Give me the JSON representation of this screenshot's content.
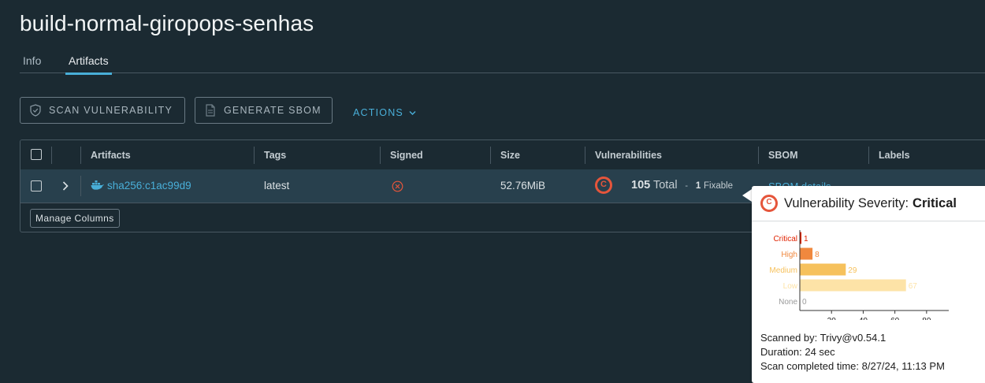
{
  "page": {
    "title": "build-normal-giropops-senhas",
    "tabs": [
      {
        "label": "Info",
        "active": false
      },
      {
        "label": "Artifacts",
        "active": true
      }
    ]
  },
  "toolbar": {
    "scan_label": "SCAN VULNERABILITY",
    "sbom_label": "GENERATE SBOM",
    "actions_label": "ACTIONS"
  },
  "grid": {
    "columns": [
      "Artifacts",
      "Tags",
      "Signed",
      "Size",
      "Vulnerabilities",
      "SBOM",
      "Labels"
    ],
    "row": {
      "digest": "sha256:c1ac99d9",
      "tag": "latest",
      "size": "52.76MiB",
      "vuln_total": "105",
      "vuln_total_word": "Total",
      "vuln_dash": "-",
      "vuln_fixable_count": "1",
      "vuln_fixable_word": "Fixable",
      "sbom_link": "SBOM details"
    },
    "manage_columns": "Manage Columns"
  },
  "popover": {
    "title_prefix": "Vulnerability Severity:",
    "title_value": "Critical",
    "icon_letter": "C",
    "scanned_by": "Scanned by: Trivy@v0.54.1",
    "duration": "Duration: 24 sec",
    "completed": "Scan completed time: 8/27/24, 11:13 PM"
  },
  "chart_data": {
    "type": "bar",
    "orientation": "horizontal",
    "categories": [
      "Critical",
      "High",
      "Medium",
      "Low",
      "None"
    ],
    "values": [
      1,
      8,
      29,
      67,
      0
    ],
    "colors": [
      "#e12200",
      "#f0883e",
      "#f6c15c",
      "#fde3a7",
      "#9a9a9a"
    ],
    "xticks": [
      20,
      40,
      60,
      80
    ],
    "xlim": [
      0,
      94
    ]
  },
  "colors": {
    "accent": "#49afd9",
    "critical": "#e5553b",
    "background": "#1b2a32",
    "row_selected": "#28404d"
  }
}
